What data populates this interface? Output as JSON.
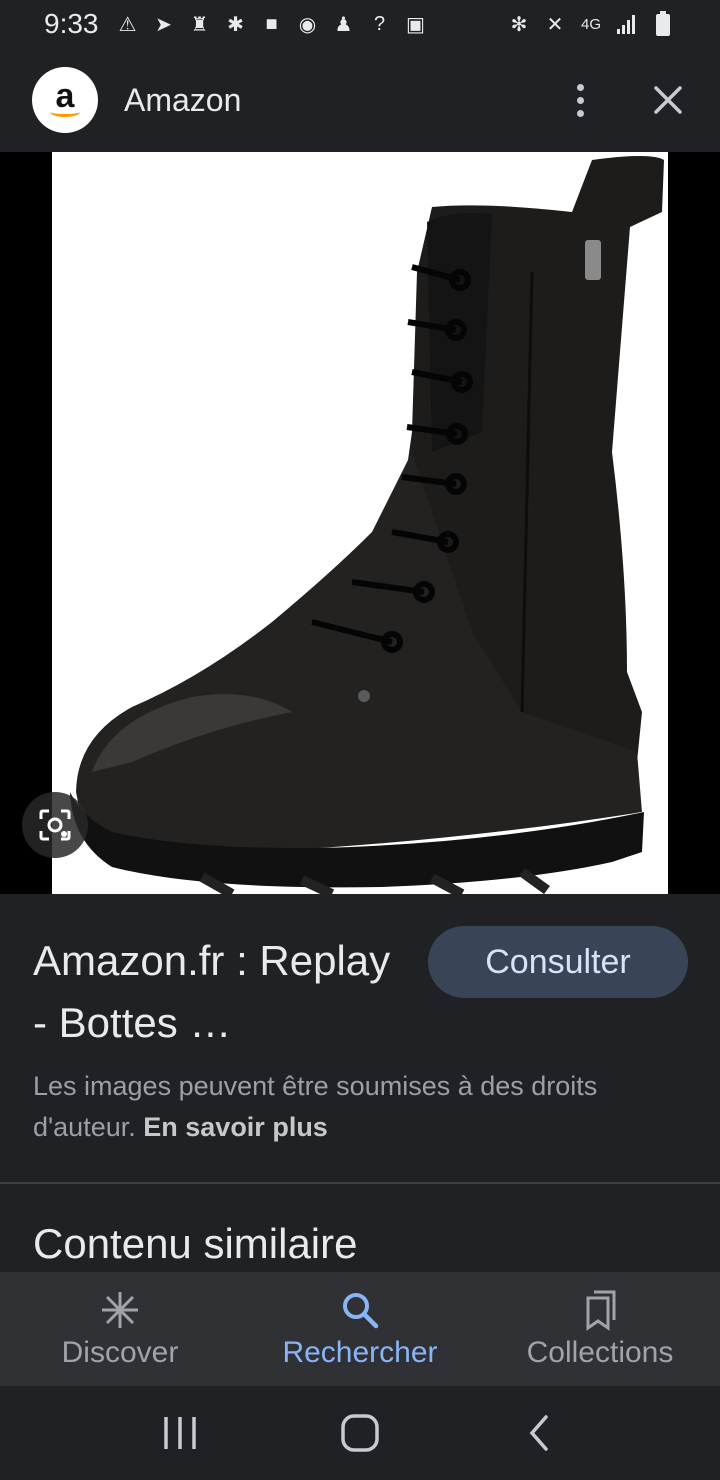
{
  "status_bar": {
    "time": "9:33",
    "network": "4G"
  },
  "header": {
    "site_name": "Amazon",
    "logo_letter": "a"
  },
  "result": {
    "title": "Amazon.fr : Replay - Bottes …",
    "visit_label": "Consulter",
    "copyright_text": "Les images peuvent être soumises à des droits d'auteur.",
    "learn_more": "En savoir plus",
    "similar_heading": "Contenu similaire"
  },
  "bottom_nav": {
    "items": [
      {
        "label": "Discover",
        "icon": "asterisk-icon"
      },
      {
        "label": "Rechercher",
        "icon": "search-icon",
        "active": true
      },
      {
        "label": "Collections",
        "icon": "bookmarks-icon"
      }
    ]
  },
  "colors": {
    "background": "#202124",
    "accent": "#8ab4f8",
    "button_bg": "#394457"
  }
}
